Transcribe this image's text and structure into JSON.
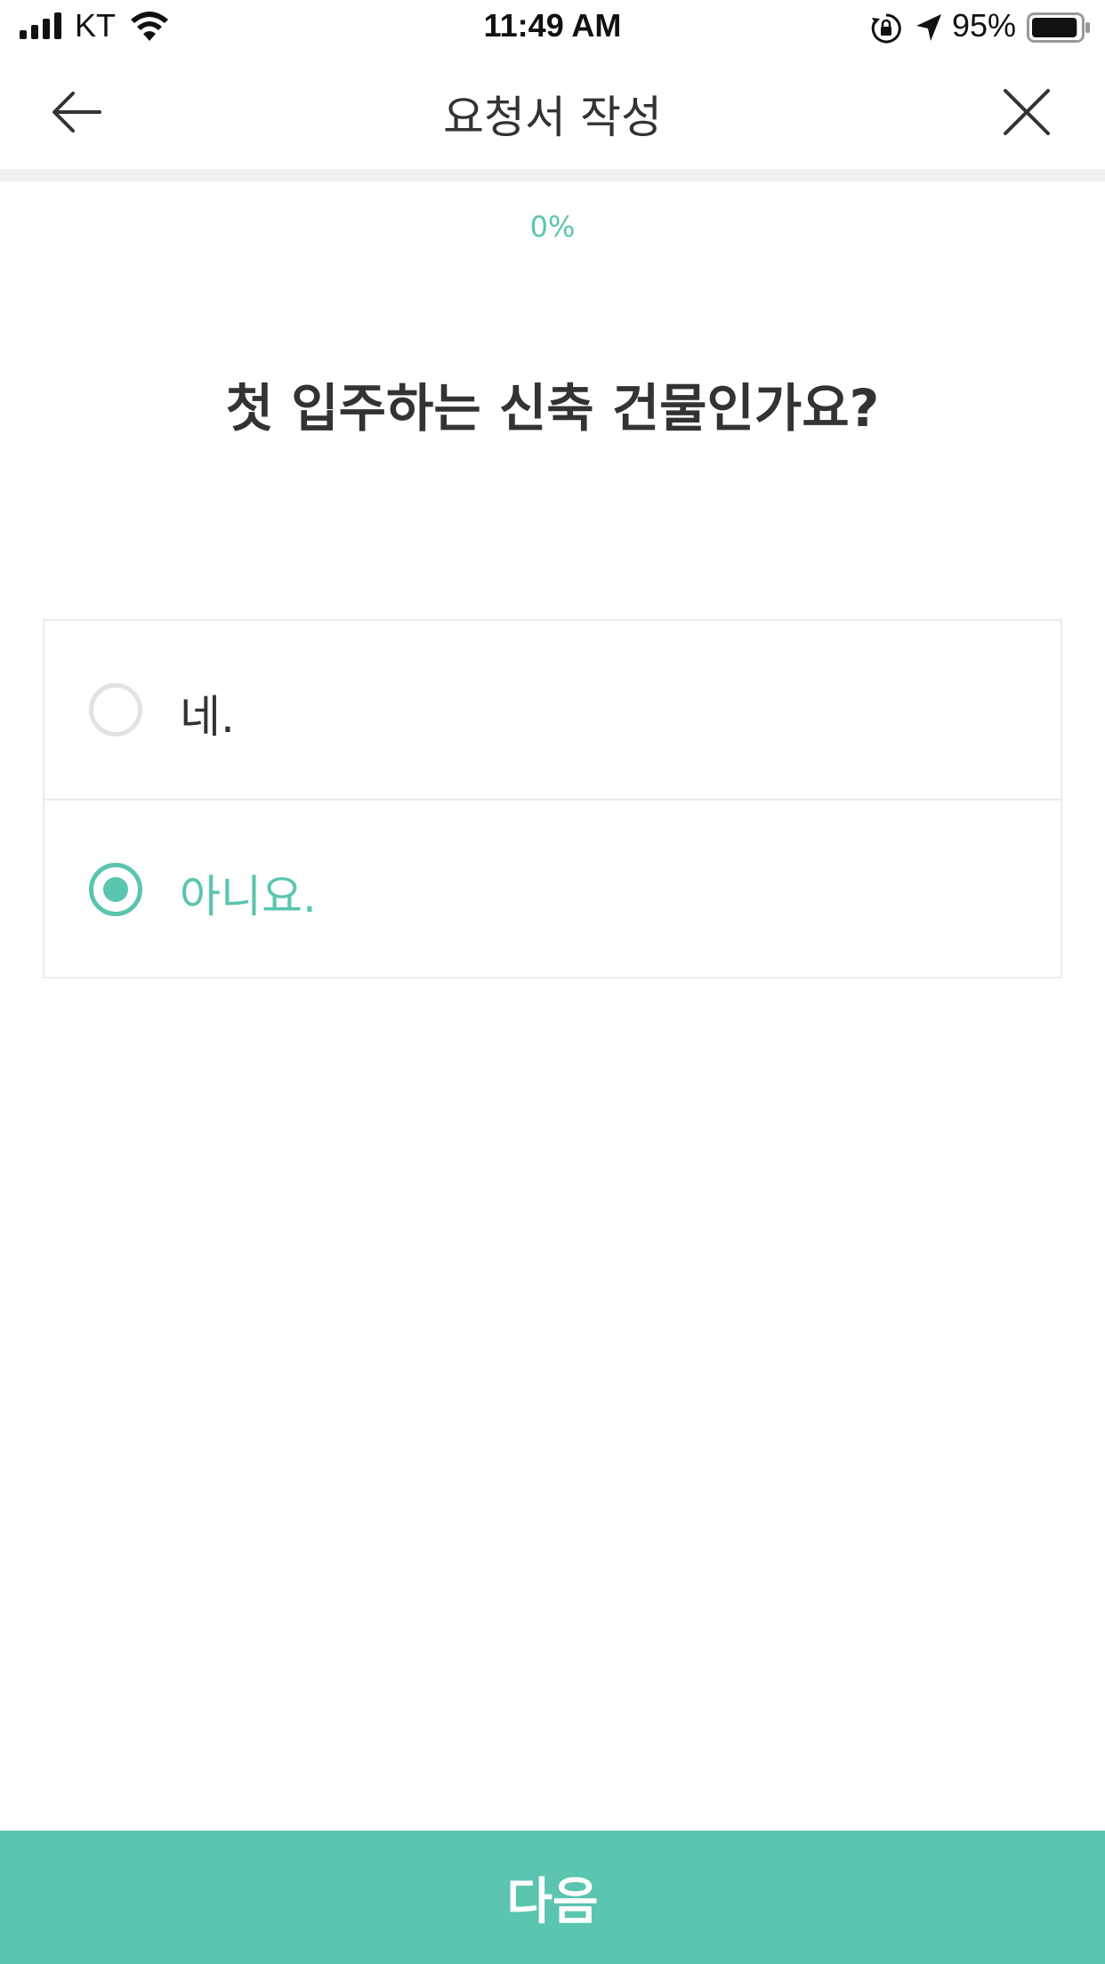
{
  "status_bar": {
    "carrier": "KT",
    "time": "11:49 AM",
    "battery_percent": "95%",
    "battery_level": 0.95,
    "icons": [
      "signal-icon",
      "wifi-icon",
      "rotation-lock-icon",
      "location-arrow-icon",
      "battery-icon"
    ]
  },
  "nav": {
    "title": "요청서 작성",
    "back_icon": "arrow-left-icon",
    "close_icon": "close-icon"
  },
  "progress": {
    "value": 0,
    "label": "0%"
  },
  "question": "첫 입주하는 신축 건물인가요?",
  "options": [
    {
      "label": "네.",
      "selected": false
    },
    {
      "label": "아니요.",
      "selected": true
    }
  ],
  "next_button": {
    "label": "다음"
  },
  "colors": {
    "accent": "#5bc5af",
    "text": "#333333",
    "border": "#ebebeb",
    "progress_track": "#f0f0f0"
  }
}
